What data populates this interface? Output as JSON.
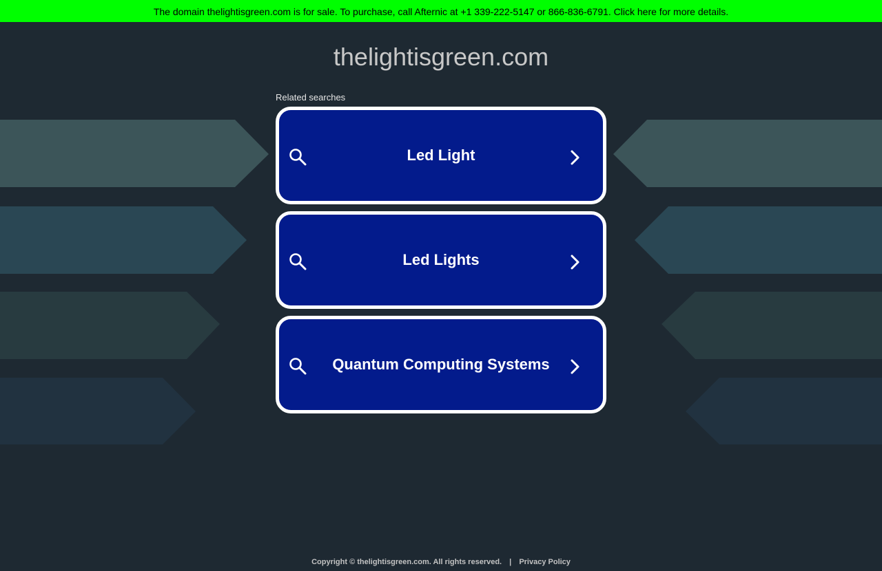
{
  "sale_banner": {
    "text": "The domain thelightisgreen.com is for sale. To purchase, call Afternic at +1 339-222-5147 or 866-836-6791. Click here for more details."
  },
  "header": {
    "domain": "thelightisgreen.com"
  },
  "related": {
    "label": "Related searches",
    "items": [
      {
        "label": "Led Light"
      },
      {
        "label": "Led Lights"
      },
      {
        "label": "Quantum Computing Systems"
      }
    ]
  },
  "footer": {
    "copyright": "Copyright © thelightisgreen.com.  All rights reserved.",
    "separator": "|",
    "privacy": "Privacy Policy"
  },
  "colors": {
    "background": "#1e2932",
    "banner": "#00ff00",
    "result_fill": "#031b8c",
    "result_border": "#ffffff"
  },
  "icons": {
    "search": "search-icon",
    "chevron": "chevron-right-icon"
  }
}
